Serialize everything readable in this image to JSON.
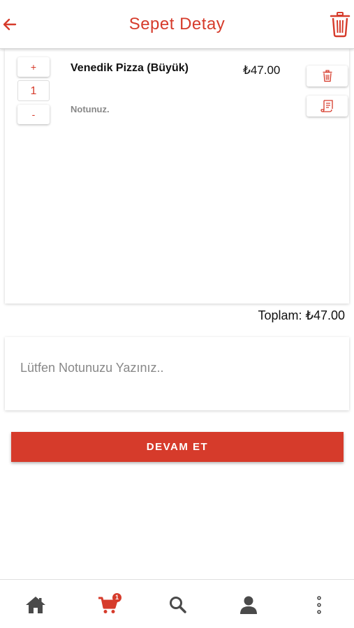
{
  "header": {
    "title": "Sepet Detay",
    "back_icon": "arrow-left-icon",
    "clear_icon": "trash-icon"
  },
  "cart": {
    "items": [
      {
        "name": "Venedik Pizza (Büyük)",
        "price": "₺47.00",
        "note": "Notunuz.",
        "quantity": "1",
        "increment_label": "+",
        "decrement_label": "-"
      }
    ],
    "total_label": "Toplam: ₺47.00"
  },
  "note_field": {
    "placeholder": "Lütfen Notunuzu Yazınız.."
  },
  "actions": {
    "continue_label": "DEVAM ET"
  },
  "bottom_nav": {
    "cart_badge": "1",
    "items": [
      "home-icon",
      "cart-icon",
      "search-icon",
      "profile-icon",
      "more-vertical-icon"
    ]
  },
  "colors": {
    "accent": "#d63b2b",
    "icon_dark": "#4a4a4a"
  }
}
